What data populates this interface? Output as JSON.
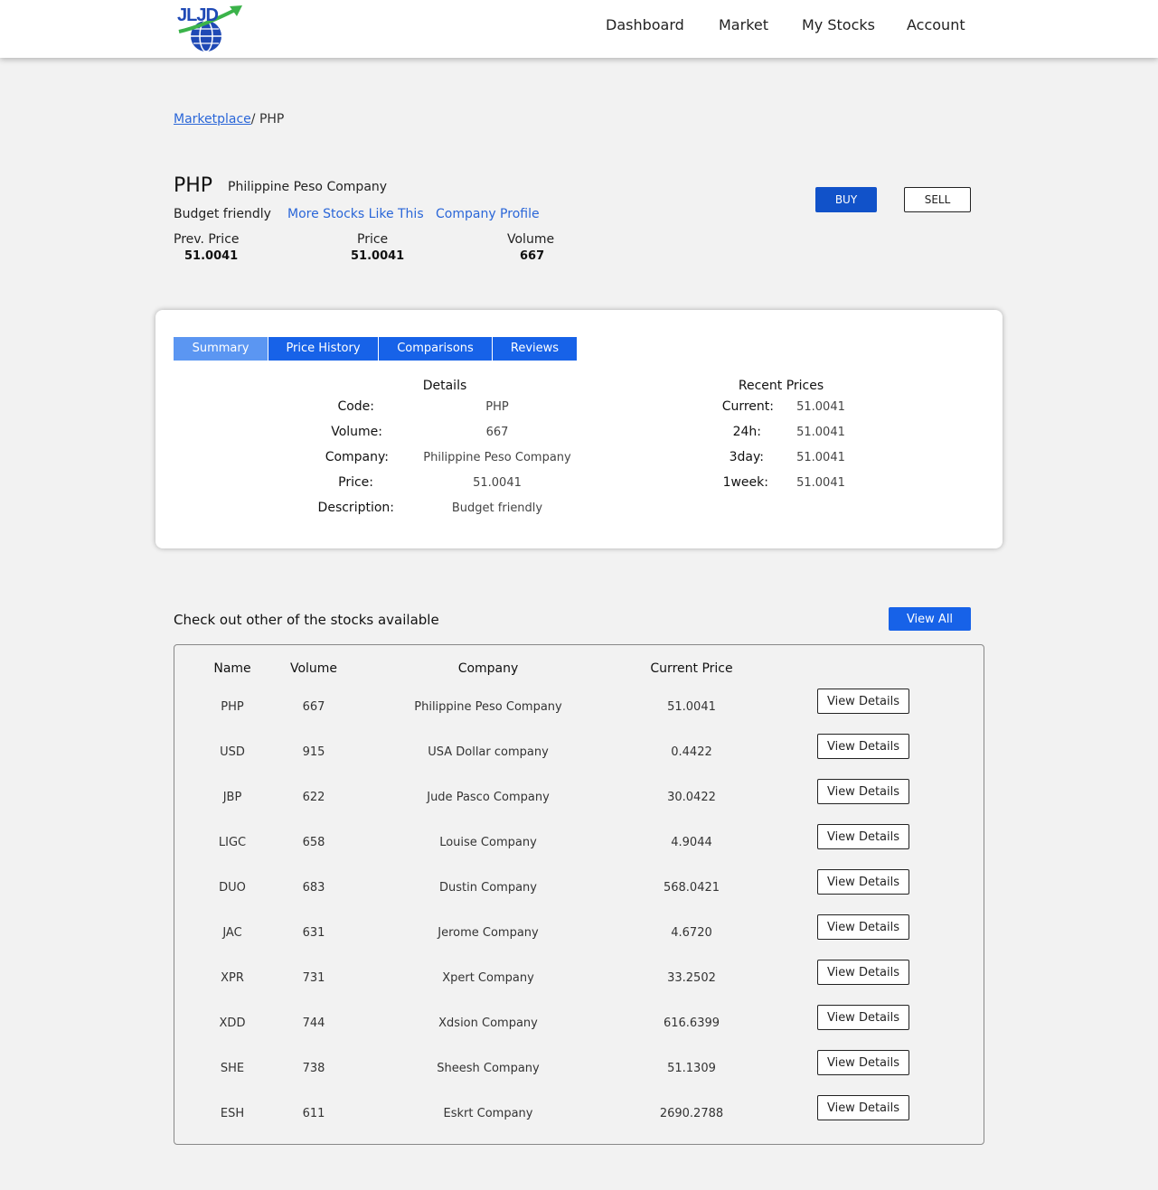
{
  "logo": {
    "text": "JLJD",
    "colors": {
      "blue": "#1f49b5",
      "green": "#3bb34a"
    }
  },
  "nav": {
    "items": [
      "Dashboard",
      "Market",
      "My Stocks",
      "Account"
    ]
  },
  "breadcrumb": {
    "link": "Marketplace",
    "current": "/ PHP"
  },
  "stock": {
    "code": "PHP",
    "company": "Philippine Peso Company",
    "tag": "Budget friendly",
    "links": [
      "More Stocks Like This",
      "Company Profile"
    ],
    "stats": [
      {
        "label": "Prev. Price",
        "value": "51.0041"
      },
      {
        "label": "Price",
        "value": "51.0041"
      },
      {
        "label": "Volume",
        "value": "667"
      }
    ]
  },
  "actions": {
    "buy": "BUY",
    "sell": "SELL"
  },
  "tabs": [
    "Summary",
    "Price History",
    "Comparisons",
    "Reviews"
  ],
  "details": {
    "title": "Details",
    "rows": [
      {
        "label": "Code:",
        "value": "PHP"
      },
      {
        "label": "Volume:",
        "value": "667"
      },
      {
        "label": "Company:",
        "value": "Philippine Peso Company"
      },
      {
        "label": "Price:",
        "value": "51.0041"
      },
      {
        "label": "Description:",
        "value": "Budget friendly"
      }
    ]
  },
  "recent": {
    "title": "Recent Prices",
    "rows": [
      {
        "label": "Current:",
        "value": "51.0041"
      },
      {
        "label": "24h:",
        "value": "51.0041"
      },
      {
        "label": "3day:",
        "value": "51.0041"
      },
      {
        "label": "1week:",
        "value": "51.0041"
      }
    ]
  },
  "others": {
    "title": "Check out other of the stocks available",
    "view_all": "View All",
    "headers": [
      "Name",
      "Volume",
      "Company",
      "Current Price"
    ],
    "button_label": "View Details",
    "rows": [
      {
        "name": "PHP",
        "volume": "667",
        "company": "Philippine Peso Company",
        "price": "51.0041"
      },
      {
        "name": "USD",
        "volume": "915",
        "company": "USA Dollar company",
        "price": "0.4422"
      },
      {
        "name": "JBP",
        "volume": "622",
        "company": "Jude Pasco Company",
        "price": "30.0422"
      },
      {
        "name": "LIGC",
        "volume": "658",
        "company": "Louise Company",
        "price": "4.9044"
      },
      {
        "name": "DUO",
        "volume": "683",
        "company": "Dustin Company",
        "price": "568.0421"
      },
      {
        "name": "JAC",
        "volume": "631",
        "company": "Jerome Company",
        "price": "4.6720"
      },
      {
        "name": "XPR",
        "volume": "731",
        "company": "Xpert Company",
        "price": "33.2502"
      },
      {
        "name": "XDD",
        "volume": "744",
        "company": "Xdsion Company",
        "price": "616.6399"
      },
      {
        "name": "SHE",
        "volume": "738",
        "company": "Sheesh Company",
        "price": "51.1309"
      },
      {
        "name": "ESH",
        "volume": "611",
        "company": "Eskrt Company",
        "price": "2690.2788"
      }
    ]
  }
}
